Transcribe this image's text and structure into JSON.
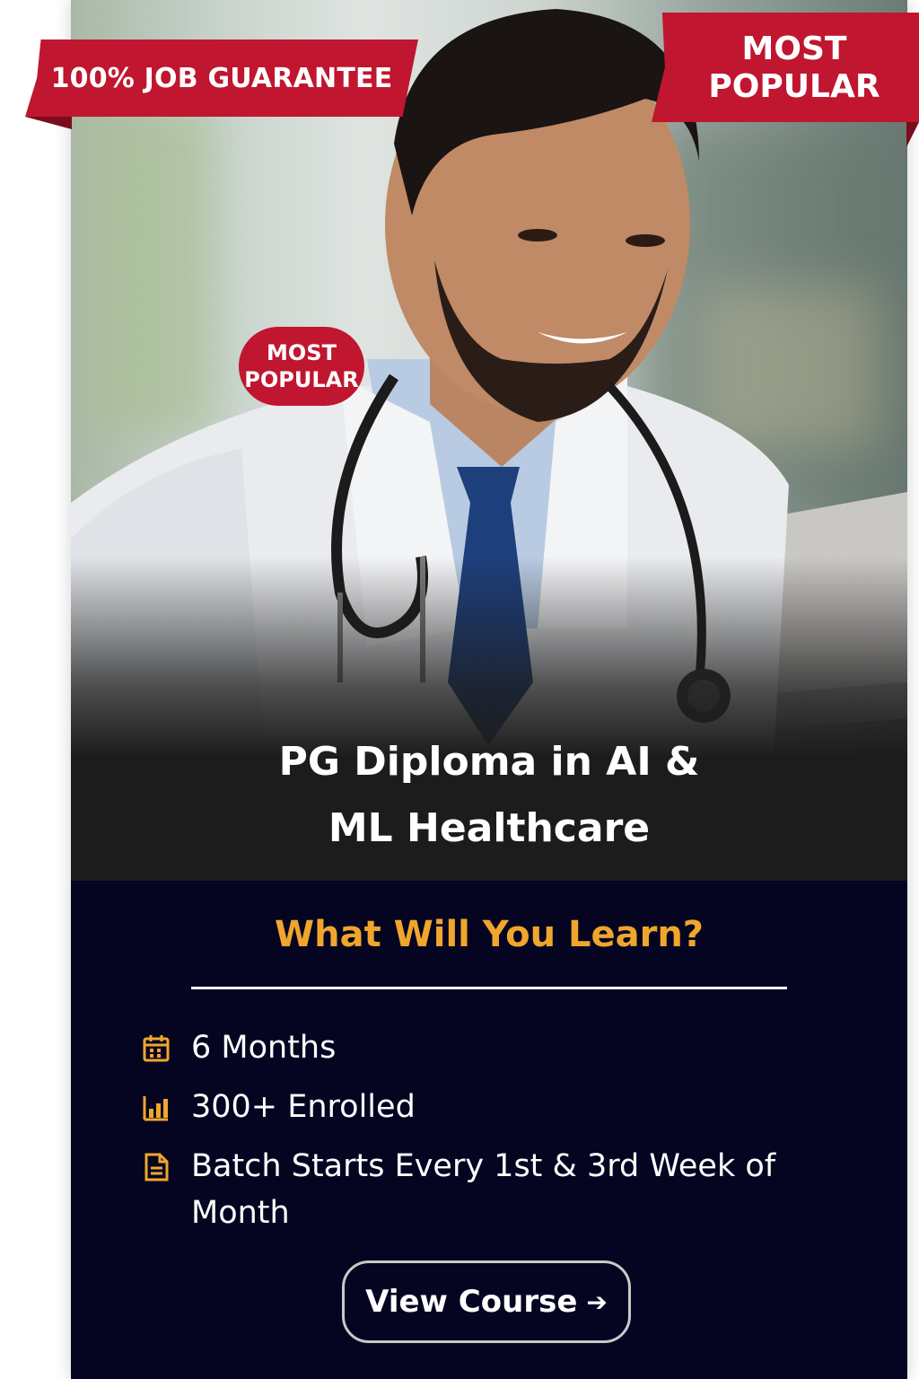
{
  "ribbons": {
    "left": "100% JOB GUARANTEE",
    "right_line1": "MOST",
    "right_line2": "POPULAR"
  },
  "badge": {
    "line1": "MOST",
    "line2": "POPULAR"
  },
  "course": {
    "title_line1": "PG Diploma in AI &",
    "title_line2": "ML Healthcare"
  },
  "learn": {
    "heading": "What Will You Learn?",
    "features": [
      {
        "icon": "calendar-icon",
        "text": "6 Months"
      },
      {
        "icon": "bar-chart-icon",
        "text": "300+ Enrolled"
      },
      {
        "icon": "document-icon",
        "text": "Batch Starts Every 1st & 3rd Week of Month"
      }
    ]
  },
  "cta": {
    "label": "View Course",
    "arrow": "➔"
  },
  "colors": {
    "accent_red": "#c0162f",
    "accent_orange": "#f0a62c",
    "navy": "#050522"
  }
}
